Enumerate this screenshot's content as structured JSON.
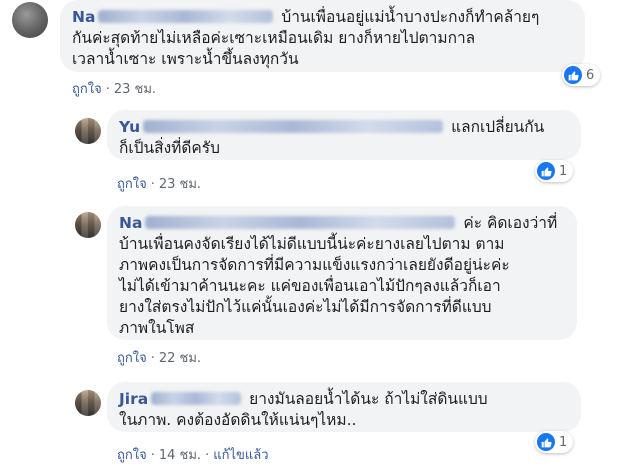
{
  "comments": [
    {
      "author_visible": "Na",
      "text_first": "บ้านเพื่อนอยู่แม่น้ำบางปะกงก็ทำคล้ายๆ",
      "text_lines": [
        "กันค่ะสุดท้ายไม่เหลือค่ะเซาะเหมือนเดิม ยางก็หายไปตามกาล",
        "เวลาน้ำเซาะ เพราะน้ำขึ้นลงทุกวัน"
      ],
      "like_label": "ถูกใจ",
      "time": "23 ชม.",
      "reaction_count": "6"
    },
    {
      "author_visible": "Yu",
      "text_first": "แลกเปลี่ยนกัน",
      "text_lines": [
        "ก็เป็นสิ่งที่ดีครับ"
      ],
      "like_label": "ถูกใจ",
      "time": "23 ชม.",
      "reaction_count": "1"
    },
    {
      "author_visible": "Na",
      "text_first": "ค่ะ คิดเองว่าที่",
      "text_lines": [
        "บ้านเพื่อนคงจัดเรียงได้ไม่ดีแบบนี้น่ะค่ะยางเลยไปตาม ตาม",
        "ภาพคงเป็นการจัดการที่มีความแข็งแรงกว่าเลยยังดีอยู่น่ะค่ะ",
        "ไม่ได้เข้ามาค้านนะคะ แค่ของเพื่อนเอาไม้ปักๆลงแล้วก็เอา",
        "ยางใส่ตรงไม่ปักไว้แค่นั้นเองค่ะไม่ได้มีการจัดการที่ดีแบบ",
        "ภาพในโพส"
      ],
      "like_label": "ถูกใจ",
      "time": "22 ชม.",
      "reaction_count": ""
    },
    {
      "author_visible": "Jira",
      "text_first": "ยางมันลอยน้ำได้นะ ถ้าไม่ใส่ดินแบบ",
      "text_lines": [
        "ในภาพ. คงต้องอัดดินให้แน่นๆไหม.."
      ],
      "like_label": "ถูกใจ",
      "time": "14 ชม.",
      "edited_label": "แก้ไขแล้ว",
      "reaction_count": "1"
    }
  ],
  "colors": {
    "link": "#385898",
    "bubble": "#f2f3f5",
    "like": "#1877f2"
  },
  "icons": {
    "reaction": "like-thumb-icon"
  }
}
